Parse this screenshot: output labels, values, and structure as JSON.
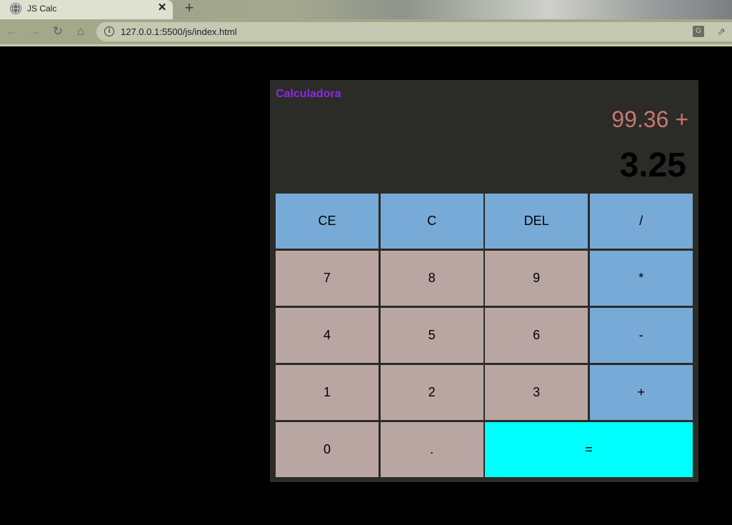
{
  "browser": {
    "tab_title": "JS Calc",
    "tab_close": "✕",
    "new_tab": "+",
    "url": "127.0.0.1:5500/js/index.html",
    "nav": {
      "back": "←",
      "forward": "→",
      "reload": "↻",
      "home": "⌂",
      "share": "⇗",
      "info": "i",
      "translate": "G"
    }
  },
  "calculator": {
    "title": "Calculadora",
    "previous_operand": "99.36 +",
    "current_operand": "3.25",
    "colors": {
      "number_key": "#b9a6a3",
      "operator_key": "#77aad7",
      "equals_key": "#00ffff",
      "title": "#8a2be2",
      "previous_operand": "#c97772"
    },
    "keys": {
      "ce": "CE",
      "c": "C",
      "del": "DEL",
      "divide": "/",
      "seven": "7",
      "eight": "8",
      "nine": "9",
      "multiply": "*",
      "four": "4",
      "five": "5",
      "six": "6",
      "minus": "-",
      "one": "1",
      "two": "2",
      "three": "3",
      "plus": "+",
      "zero": "0",
      "dot": ".",
      "equals": "="
    }
  }
}
